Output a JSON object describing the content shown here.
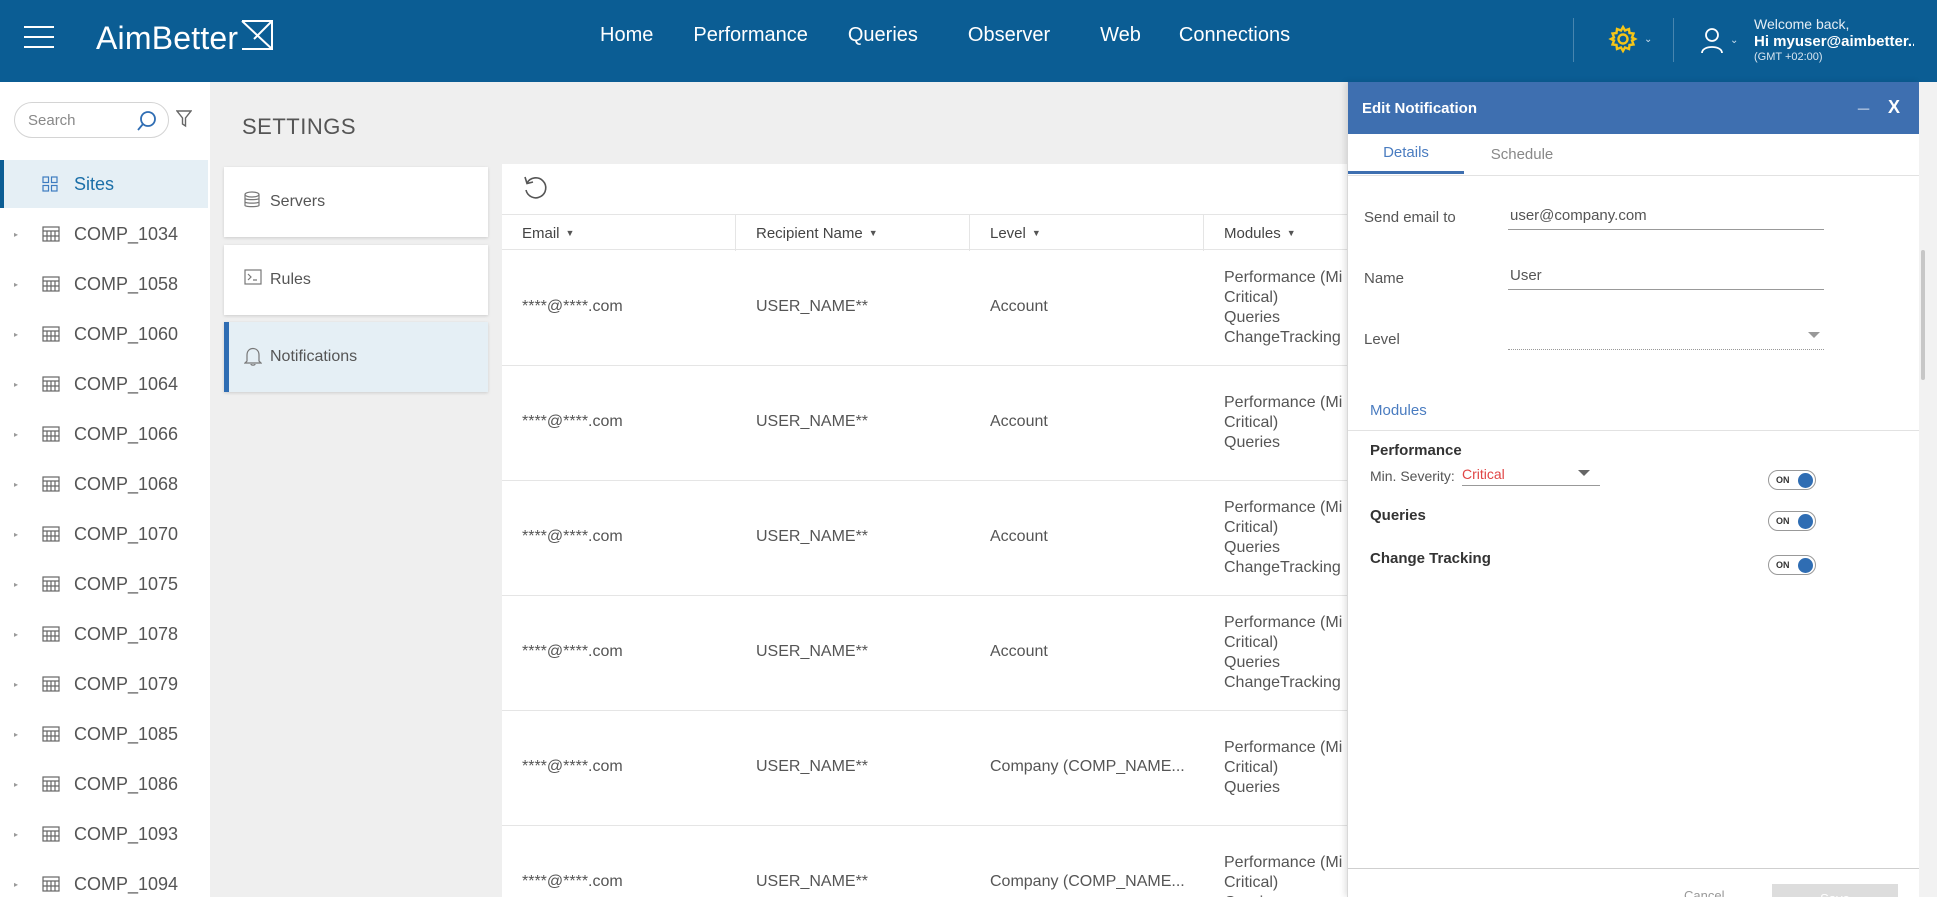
{
  "header": {
    "logo_text": "AimBetter",
    "nav": [
      "Home",
      "Performance",
      "Queries",
      "Observer",
      "Web",
      "Connections"
    ],
    "welcome_line": "Welcome back,",
    "user_line": "Hi myuser@aimbetter....",
    "timezone_line": "(GMT +02:00)",
    "gear_color": "#f5c518"
  },
  "sidebar": {
    "search_placeholder": "Search",
    "items": [
      {
        "label": "Sites",
        "icon": "grid-icon",
        "selected": true
      },
      {
        "label": "COMP_1034",
        "icon": "building-icon"
      },
      {
        "label": "COMP_1058",
        "icon": "building-icon"
      },
      {
        "label": "COMP_1060",
        "icon": "building-icon"
      },
      {
        "label": "COMP_1064",
        "icon": "building-icon"
      },
      {
        "label": "COMP_1066",
        "icon": "building-icon"
      },
      {
        "label": "COMP_1068",
        "icon": "building-icon"
      },
      {
        "label": "COMP_1070",
        "icon": "building-icon"
      },
      {
        "label": "COMP_1075",
        "icon": "building-icon"
      },
      {
        "label": "COMP_1078",
        "icon": "building-icon"
      },
      {
        "label": "COMP_1079",
        "icon": "building-icon"
      },
      {
        "label": "COMP_1085",
        "icon": "building-icon"
      },
      {
        "label": "COMP_1086",
        "icon": "building-icon"
      },
      {
        "label": "COMP_1093",
        "icon": "building-icon"
      },
      {
        "label": "COMP_1094",
        "icon": "building-icon"
      }
    ]
  },
  "settings": {
    "title": "SETTINGS",
    "menu": [
      {
        "label": "Servers",
        "icon": "database-icon"
      },
      {
        "label": "Rules",
        "icon": "terminal-icon"
      },
      {
        "label": "Notifications",
        "icon": "bell-icon",
        "active": true
      }
    ]
  },
  "table": {
    "columns": [
      "Email",
      "Recipient Name",
      "Level",
      "Modules"
    ],
    "rows": [
      {
        "email": "****@****.com",
        "name": "USER_NAME**",
        "level": "Account",
        "modules": [
          "Performance (Mi",
          "Critical)",
          "Queries",
          "ChangeTracking"
        ]
      },
      {
        "email": "****@****.com",
        "name": "USER_NAME**",
        "level": "Account",
        "modules": [
          "Performance (Mi",
          "Critical)",
          "Queries"
        ]
      },
      {
        "email": "****@****.com",
        "name": "USER_NAME**",
        "level": "Account",
        "modules": [
          "Performance (Mi",
          "Critical)",
          "Queries",
          "ChangeTracking"
        ]
      },
      {
        "email": "****@****.com",
        "name": "USER_NAME**",
        "level": "Account",
        "modules": [
          "Performance (Mi",
          "Critical)",
          "Queries",
          "ChangeTracking"
        ]
      },
      {
        "email": "****@****.com",
        "name": "USER_NAME**",
        "level": "Company (COMP_NAME...",
        "modules": [
          "Performance (Mi",
          "Critical)",
          "Queries"
        ]
      },
      {
        "email": "****@****.com",
        "name": "USER_NAME**",
        "level": "Company (COMP_NAME...",
        "modules": [
          "Performance (Mi",
          "Critical)",
          "Queries"
        ]
      }
    ]
  },
  "edit": {
    "title": "Edit Notification",
    "minimize": "_",
    "close": "X",
    "tabs": [
      "Details",
      "Schedule"
    ],
    "email_label": "Send email to",
    "email_value": "user@company.com",
    "name_label": "Name",
    "name_value": "User",
    "level_label": "Level",
    "level_value": "",
    "modules_label": "Modules",
    "performance_label": "Performance",
    "min_severity_label": "Min. Severity:",
    "severity_value": "Critical",
    "severity_color": "#e04545",
    "queries_label": "Queries",
    "change_tracking_label": "Change Tracking",
    "toggle_on": "ON",
    "toggle_color": "#2f6db3",
    "cancel_label": "Cancel",
    "save_label": "Save"
  }
}
